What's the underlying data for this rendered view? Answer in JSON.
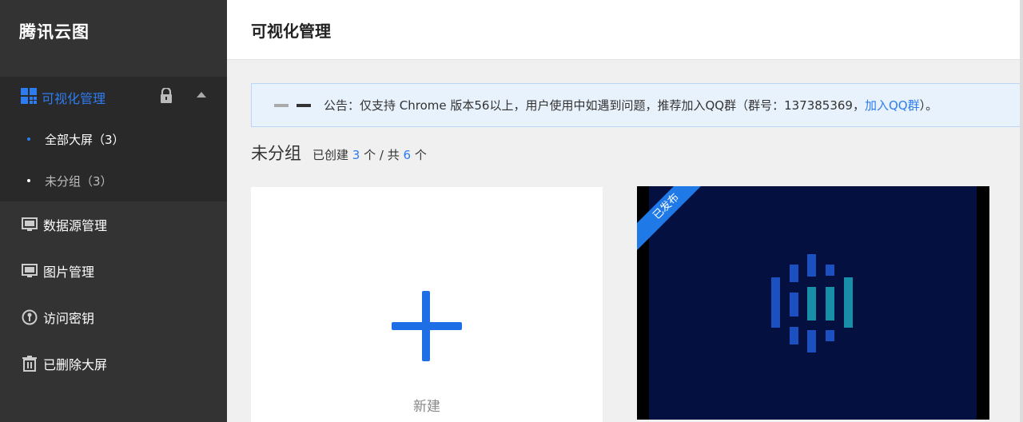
{
  "brand": "腾讯云图",
  "sidebar": {
    "group": {
      "label": "可视化管理"
    },
    "sub_items": [
      {
        "label": "全部大屏（3）"
      },
      {
        "label": "未分组（3）"
      }
    ],
    "items": [
      {
        "label": "数据源管理",
        "icon": "monitor-icon"
      },
      {
        "label": "图片管理",
        "icon": "image-icon"
      },
      {
        "label": "访问密钥",
        "icon": "key-icon"
      },
      {
        "label": "已删除大屏",
        "icon": "trash-icon"
      }
    ]
  },
  "header": {
    "title": "可视化管理"
  },
  "notice": {
    "text": "公告：仅支持 Chrome 版本56以上，用户使用中如遇到问题，推荐加入QQ群（群号：137385369，",
    "link": "加入QQ群",
    "tail": "）。"
  },
  "group": {
    "name": "未分组",
    "created_prefix": "已创建",
    "created_count": "3",
    "unit1": "个 / 共",
    "total_count": "6",
    "unit2": "个"
  },
  "cards": {
    "new_label": "新建",
    "screen_badge": "已发布"
  },
  "colors": {
    "accent": "#2d7cf0",
    "sidebar_bg": "#333333",
    "screen_bg": "#04103f"
  }
}
